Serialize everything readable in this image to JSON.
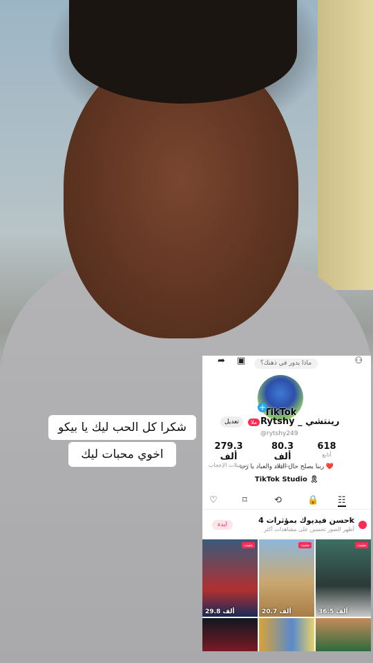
{
  "captions": {
    "line1": "شكرا كل الحب ليك يا بيكو",
    "line2": "اخوي محبات ليك"
  },
  "profile": {
    "prompt_bubble": "ماذا يدور في ذهنك؟",
    "avatar_logo": "TikTok",
    "edit_label": "تعديل",
    "badge": "ملا",
    "name": "Rytshy _ رينتشي",
    "handle": "@rytshy249",
    "stats": [
      {
        "value": "279.3 ألف",
        "label": "تسجيلات الإعجاب"
      },
      {
        "value": "80.3 ألف",
        "label": "متابعين"
      },
      {
        "value": "618",
        "label": "أتابع"
      }
    ],
    "bio": "ربنا يصلح حال البلاد والعباد يا رب ❤️",
    "studio_label": "TikTok Studio 🎗",
    "tabs": [
      "heart-icon",
      "bookmark-icon",
      "repost-icon",
      "lock-icon",
      "grid-icon"
    ]
  },
  "playlist": {
    "title": "حسن فيديوك بمؤثرات 4k",
    "subtitle": "أظهر الصور تحسين على مشاهدات أكثر",
    "start_label": "ابدء"
  },
  "videos": [
    {
      "views": "29.8 ألف",
      "pinned": "مثبت"
    },
    {
      "views": "20.7 ألف",
      "pinned": "مثبت"
    },
    {
      "views": "36.5 ألف",
      "pinned": "مثبت"
    },
    {
      "views": "",
      "pinned": ""
    },
    {
      "views": "",
      "pinned": ""
    },
    {
      "views": "",
      "pinned": ""
    }
  ]
}
